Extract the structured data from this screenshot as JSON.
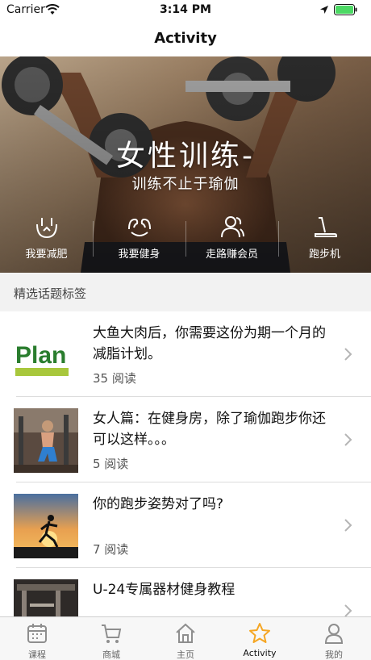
{
  "status_bar": {
    "carrier": "Carrier",
    "time": "3:14 PM"
  },
  "nav": {
    "title": "Activity"
  },
  "hero": {
    "title": "女性训练-",
    "subtitle": "训练不止于瑜伽",
    "categories": [
      {
        "label": "我要减肥",
        "icon": "scale-icon"
      },
      {
        "label": "我要健身",
        "icon": "flex-arm-icon"
      },
      {
        "label": "走路赚会员",
        "icon": "people-icon"
      },
      {
        "label": "跑步机",
        "icon": "treadmill-icon"
      }
    ]
  },
  "section": {
    "title": "精选话题标签"
  },
  "articles": [
    {
      "title": "大鱼大肉后，你需要这份为期一个月的减脂计划。",
      "reads": "35 阅读",
      "thumb_text": "Plan"
    },
    {
      "title": "女人篇：在健身房，除了瑜伽跑步你还可以这样。。。",
      "reads": "5 阅读"
    },
    {
      "title": "你的跑步姿势对了吗?",
      "reads": "7 阅读"
    },
    {
      "title": "U-24专属器材健身教程",
      "reads": ""
    }
  ],
  "tab_bar": {
    "active_index": 3,
    "tabs": [
      {
        "label": "课程",
        "icon": "calendar-icon"
      },
      {
        "label": "商城",
        "icon": "cart-icon"
      },
      {
        "label": "主页",
        "icon": "home-icon"
      },
      {
        "label": "Activity",
        "icon": "star-icon"
      },
      {
        "label": "我的",
        "icon": "person-icon"
      }
    ]
  },
  "colors": {
    "accent": "#f5a623",
    "plan_green": "#2a7d2e",
    "plan_bar": "#a8c73c",
    "battery": "#4cd964"
  }
}
